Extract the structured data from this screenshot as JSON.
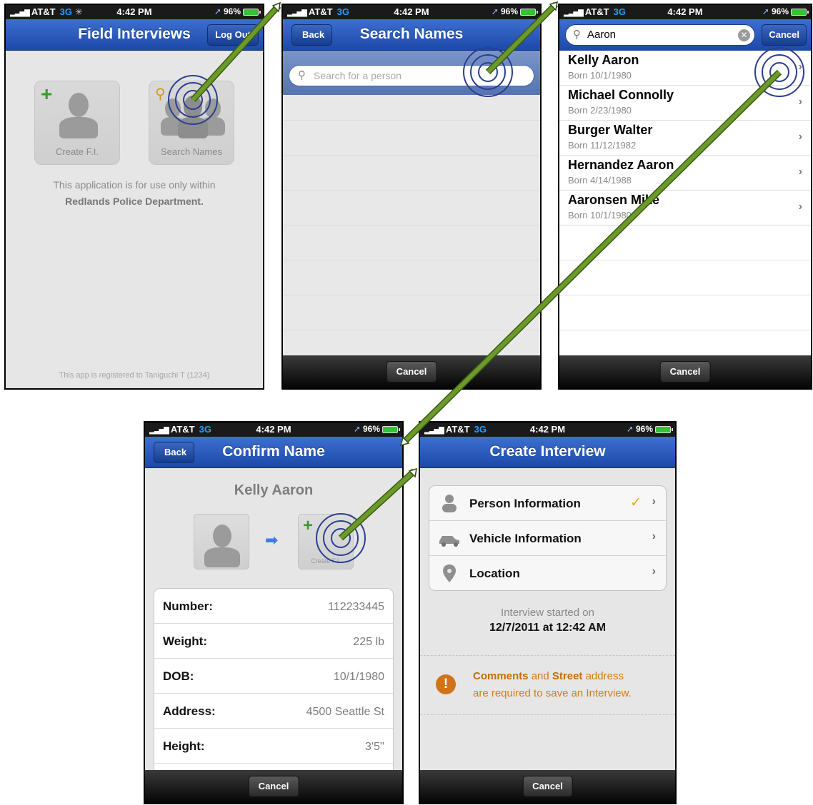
{
  "status": {
    "carrier": "AT&T",
    "network": "3G",
    "time": "4:42 PM",
    "battery": "96",
    "battery_unit": "%",
    "signal_glyph": "▂▃▅▇",
    "location_glyph": "➚"
  },
  "screen1": {
    "title": "Field Interviews",
    "logout": "Log Out",
    "tile_create": "Create F.I.",
    "tile_search": "Search Names",
    "info_line1": "This application is for use only within",
    "info_line2": "Redlands Police Department.",
    "footer": "This app is registered to Taniguchi T (1234)"
  },
  "screen2": {
    "back": "Back",
    "title": "Search Names",
    "placeholder": "Search for a person",
    "cancel": "Cancel"
  },
  "screen3": {
    "query": "Aaron",
    "cancel_top": "Cancel",
    "results": [
      {
        "name": "Kelly Aaron",
        "born": "Born 10/1/1980"
      },
      {
        "name": "Michael Connolly",
        "born": "Born 2/23/1980"
      },
      {
        "name": "Burger Walter",
        "born": "Born 11/12/1982"
      },
      {
        "name": "Hernandez Aaron",
        "born": "Born 4/14/1988"
      },
      {
        "name": "Aaronsen Mike",
        "born": "Born 10/1/1980"
      }
    ],
    "cancel": "Cancel"
  },
  "screen4": {
    "back": "Back",
    "title": "Confirm Name",
    "person": "Kelly  Aaron",
    "create_label": "Create F.I.",
    "details": [
      {
        "key": "Number:",
        "value": "112233445"
      },
      {
        "key": "Weight:",
        "value": "225 lb"
      },
      {
        "key": "DOB:",
        "value": "10/1/1980"
      },
      {
        "key": "Address:",
        "value": "4500 Seattle St"
      },
      {
        "key": "Height:",
        "value": "3'5''"
      }
    ],
    "cancel": "Cancel"
  },
  "screen5": {
    "title": "Create Interview",
    "rows": [
      {
        "label": "Person Information",
        "icon": "person-icon",
        "checked": true
      },
      {
        "label": "Vehicle Information",
        "icon": "car-icon",
        "checked": false
      },
      {
        "label": "Location",
        "icon": "map-pin-icon",
        "checked": false
      }
    ],
    "started_label": "Interview started on",
    "started_time": "12/7/2011 at 12:42 AM",
    "warning_comments": "Comments",
    "warning_and": "and",
    "warning_street": "Street",
    "warning_rest1": "address",
    "warning_line2": "are required to save an Interview.",
    "cancel": "Cancel"
  },
  "colors": {
    "nav_blue": "#1d49a8",
    "arrow_green": "#5a8a1e",
    "ring_blue": "#2a3f8f",
    "warning": "#d07d13",
    "check": "#e8a617"
  }
}
